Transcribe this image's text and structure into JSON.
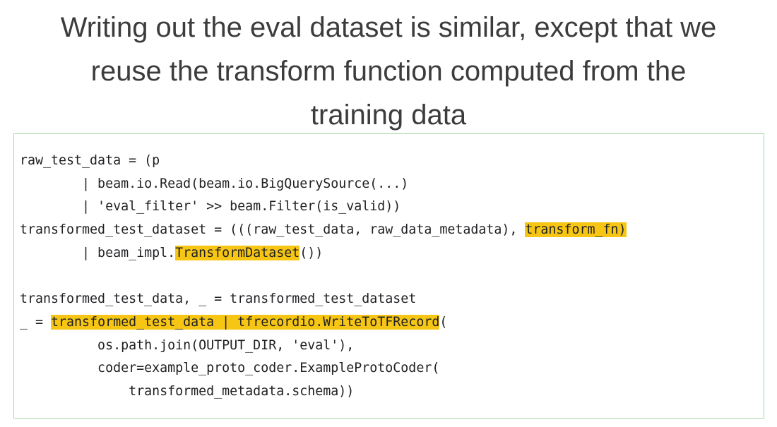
{
  "slide": {
    "title_lines": [
      "Writing out the eval dataset is similar, except that we",
      "reuse the transform function computed from the",
      "training data"
    ]
  },
  "colors": {
    "highlight": "#f7c614",
    "box_border": "#a8d5a8",
    "title_text": "#3c3c3c",
    "code_text": "#202124"
  },
  "code": {
    "lines": [
      [
        {
          "text": "raw_test_data = (p",
          "hl": false
        }
      ],
      [
        {
          "text": "        | beam.io.Read(beam.io.BigQuerySource(...)",
          "hl": false
        }
      ],
      [
        {
          "text": "        | 'eval_filter' >> beam.Filter(is_valid))",
          "hl": false
        }
      ],
      [
        {
          "text": "transformed_test_dataset = (((raw_test_data, raw_data_metadata), ",
          "hl": false
        },
        {
          "text": "transform_fn)",
          "hl": true
        }
      ],
      [
        {
          "text": "        | beam_impl.",
          "hl": false
        },
        {
          "text": "TransformDataset",
          "hl": true
        },
        {
          "text": "())",
          "hl": false
        }
      ],
      [
        {
          "text": "",
          "hl": false
        }
      ],
      [
        {
          "text": "transformed_test_data, _ = transformed_test_dataset",
          "hl": false
        }
      ],
      [
        {
          "text": "_ = ",
          "hl": false
        },
        {
          "text": "transformed_test_data | tfrecordio.WriteToTFRecord",
          "hl": true
        },
        {
          "text": "(",
          "hl": false
        }
      ],
      [
        {
          "text": "          os.path.join(OUTPUT_DIR, 'eval'),",
          "hl": false
        }
      ],
      [
        {
          "text": "          coder=example_proto_coder.ExampleProtoCoder(",
          "hl": false
        }
      ],
      [
        {
          "text": "              transformed_metadata.schema))",
          "hl": false
        }
      ]
    ]
  }
}
